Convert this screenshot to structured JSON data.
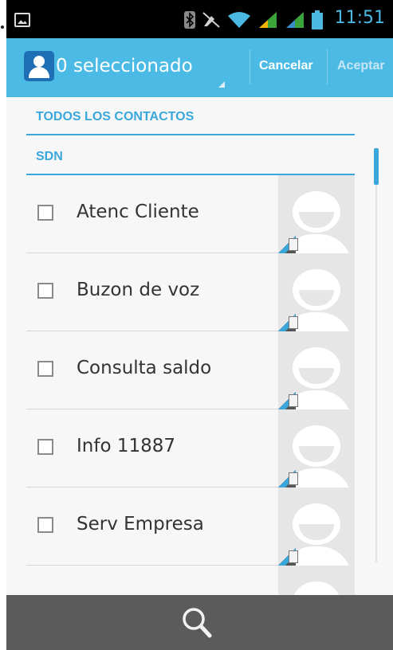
{
  "status_bar": {
    "time": "11:51",
    "icons": [
      "picture-icon",
      "bluetooth-icon",
      "mute-icon",
      "wifi-icon",
      "signal-icon",
      "signal-icon",
      "battery-icon"
    ],
    "accent_color": "#4bb8e4"
  },
  "action_bar": {
    "title": "0 seleccionado",
    "cancel_label": "Cancelar",
    "accept_label": "Aceptar",
    "background_color": "#4bbbe5"
  },
  "sections": {
    "all_contacts": "TODOS LOS CONTACTOS",
    "sdn": "SDN"
  },
  "contacts": [
    {
      "name": "Atenc Cliente"
    },
    {
      "name": "Buzon de voz"
    },
    {
      "name": "Consulta saldo"
    },
    {
      "name": "Info 11887"
    },
    {
      "name": "Serv Empresa"
    }
  ],
  "bottom_bar": {
    "icon": "search-icon"
  }
}
